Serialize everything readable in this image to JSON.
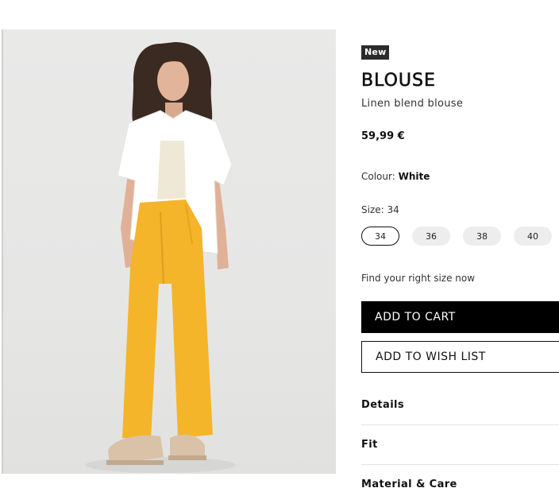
{
  "product": {
    "badge": "New",
    "title": "BLOUSE",
    "subtitle": "Linen blend blouse",
    "price": "59,99 €",
    "colour_label": "Colour:",
    "colour_value": "White",
    "size_label": "Size:",
    "size_value": "34",
    "sizes": [
      {
        "label": "34",
        "selected": true
      },
      {
        "label": "36",
        "selected": false
      },
      {
        "label": "38",
        "selected": false
      },
      {
        "label": "40",
        "selected": false
      }
    ],
    "find_size_link": "Find your right size now",
    "add_to_cart": "ADD TO CART",
    "add_to_wish_list": "ADD TO WISH LIST"
  },
  "accordion": {
    "details": "Details",
    "fit": "Fit",
    "material": "Material & Care"
  },
  "image": {
    "subject": "Model wearing white linen blend blouse over cream top with yellow wide-leg trousers and beige sandals",
    "colors": {
      "background": "#e7e7e6",
      "blouse": "#ffffff",
      "trousers": "#f4b52a",
      "hair": "#3a2a22",
      "sandals": "#d9c2a8"
    }
  }
}
